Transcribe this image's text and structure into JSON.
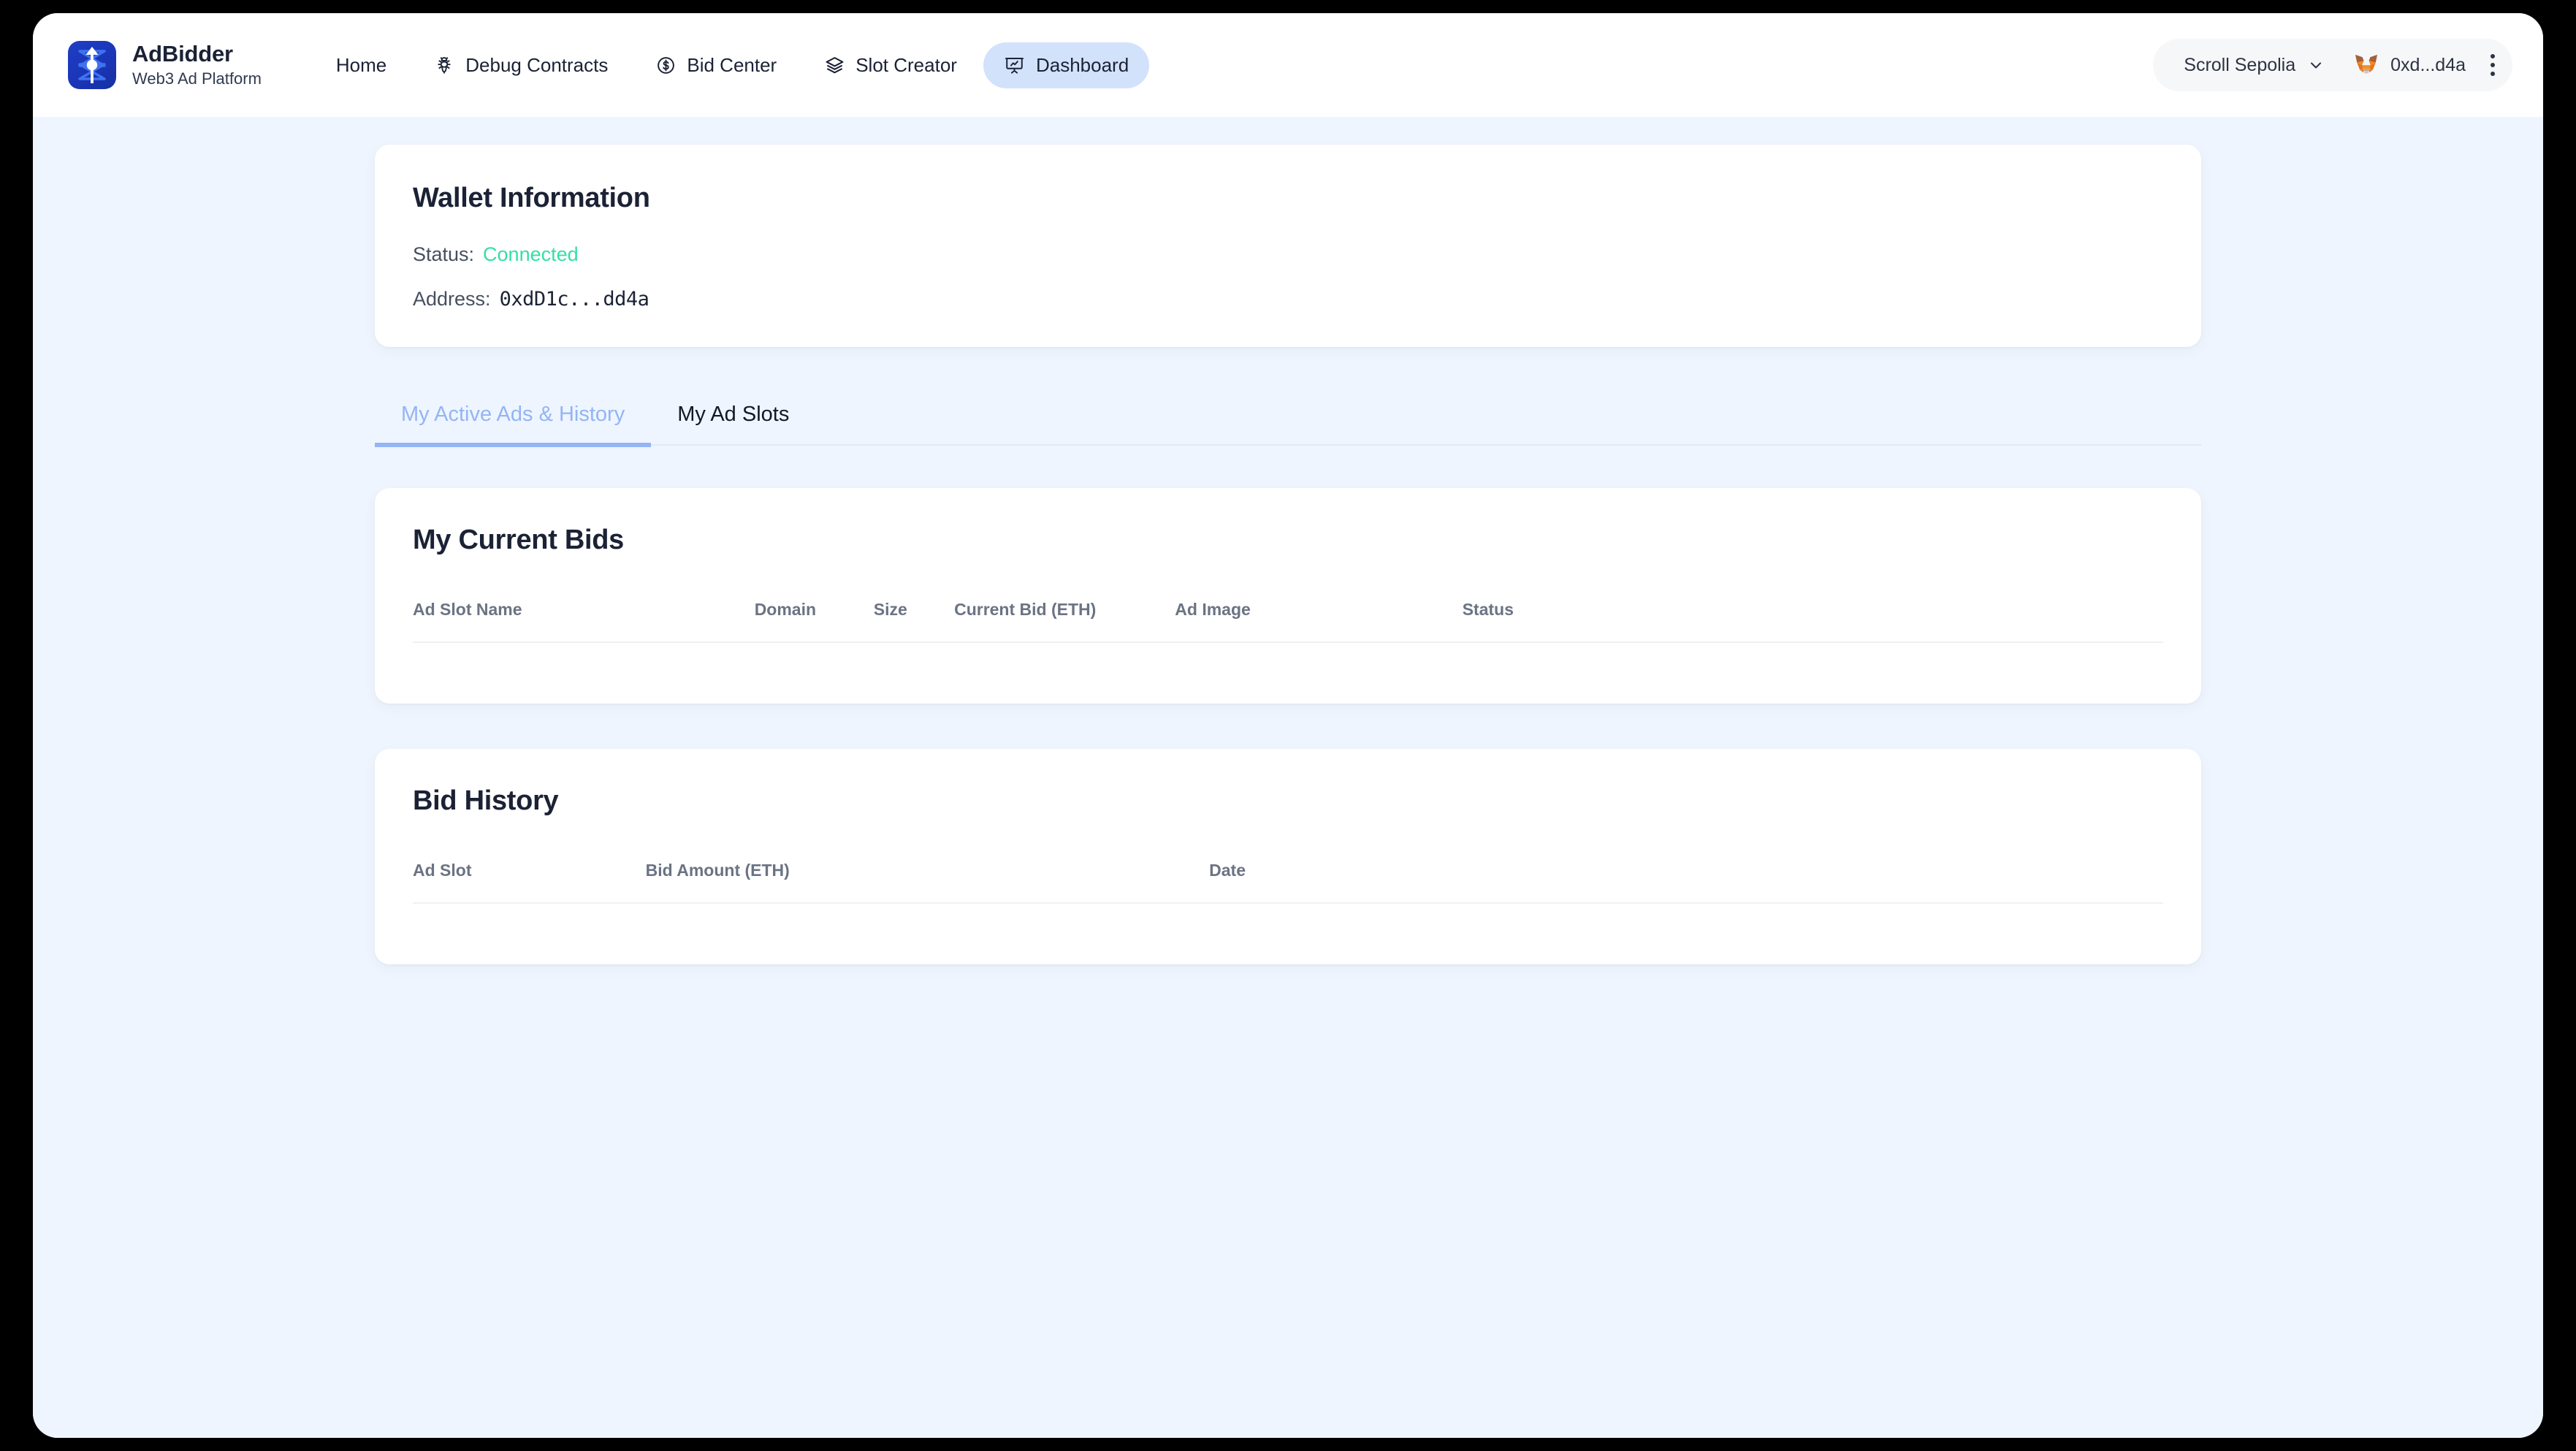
{
  "brand": {
    "name": "AdBidder",
    "tagline": "Web3 Ad Platform",
    "logo_icon": "adbidder-logo-icon"
  },
  "nav": {
    "items": [
      {
        "label": "Home",
        "icon": "",
        "active": false
      },
      {
        "label": "Debug Contracts",
        "icon": "bug-icon",
        "active": false
      },
      {
        "label": "Bid Center",
        "icon": "dollar-circle-icon",
        "active": false
      },
      {
        "label": "Slot Creator",
        "icon": "layers-icon",
        "active": false
      },
      {
        "label": "Dashboard",
        "icon": "presentation-chart-icon",
        "active": true
      }
    ]
  },
  "header_right": {
    "network": "Scroll Sepolia",
    "network_chevron_icon": "chevron-down-icon",
    "wallet_icon": "metamask-fox-icon",
    "account": "0xd...d4a",
    "kebab_icon": "more-vertical-icon"
  },
  "wallet": {
    "title": "Wallet Information",
    "status_label": "Status:",
    "status_value": "Connected",
    "address_label": "Address:",
    "address_value": "0xdD1c...dd4a"
  },
  "tabs": [
    {
      "label": "My Active Ads & History",
      "active": true
    },
    {
      "label": "My Ad Slots",
      "active": false
    }
  ],
  "current_bids": {
    "title": "My Current Bids",
    "columns": [
      "Ad Slot Name",
      "Domain",
      "Size",
      "Current Bid (ETH)",
      "Ad Image",
      "Status"
    ],
    "rows": []
  },
  "bid_history": {
    "title": "Bid History",
    "columns": [
      "Ad Slot",
      "Bid Amount (ETH)",
      "Date"
    ],
    "rows": []
  },
  "colors": {
    "page_background": "#eff5fe",
    "card_background": "#ffffff",
    "accent_blue": "#93b5f4",
    "active_pill": "#d3e2fb",
    "status_green": "#34e0a1",
    "brand_blue": "#1e3fc4",
    "text_dark": "#1b2235",
    "text_muted": "#6b7383"
  }
}
